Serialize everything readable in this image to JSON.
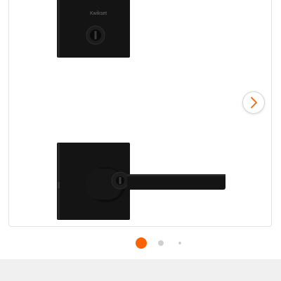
{
  "gallery": {
    "deadbolt_brand_text": "Kwikset",
    "next_icon": "chevron-right-icon",
    "total_images": 3,
    "active_index": 0
  },
  "colors": {
    "accent": "#f96302",
    "hardware": "#141414",
    "dot_inactive": "#cfcfcf",
    "card_border": "#e3e3e3",
    "bottom_bar": "#f0f0f0"
  }
}
